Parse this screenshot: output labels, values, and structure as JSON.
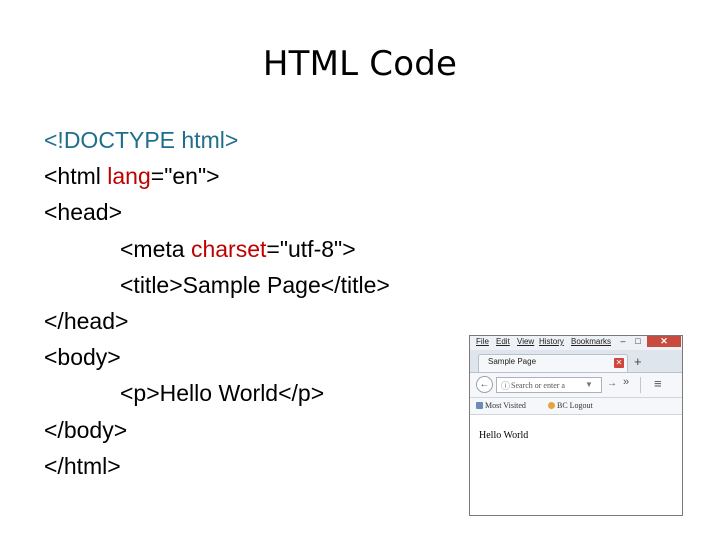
{
  "title": "HTML Code",
  "code": {
    "line1": {
      "text": "<!DOCTYPE html>"
    },
    "line2": {
      "open": "<html ",
      "attr": "lang",
      "value": "=\"en\">"
    },
    "line3": {
      "text": "<head>"
    },
    "line4": {
      "open": "<meta ",
      "attr": "charset",
      "value": "=\"utf-8\">"
    },
    "line5": {
      "text": "<title>Sample Page</title>"
    },
    "line6": {
      "text": "</head>"
    },
    "line7": {
      "text": "<body>"
    },
    "line8": {
      "text": "<p>Hello World</p>"
    },
    "line9": {
      "text": "</body>"
    },
    "line10": {
      "text": "</html>"
    }
  },
  "colors": {
    "doctype": "#1f6e8c",
    "attribute": "#c00000",
    "text": "#000000"
  },
  "browser": {
    "menu": [
      "File",
      "Edit",
      "View",
      "History",
      "Bookmarks"
    ],
    "controls": {
      "minimize": "–",
      "maximize": "□",
      "close": "✕"
    },
    "tab_label": "Sample Page",
    "tab_close": "✕",
    "new_tab": "+",
    "back": "←",
    "info": "ⓘ",
    "url_placeholder": "Search or enter a",
    "dropdown": "▼",
    "go": "→",
    "more": "»",
    "menu_icon": "≡",
    "bookmarks": [
      "Most Visited",
      "BC Logout"
    ],
    "page_text": "Hello World"
  }
}
